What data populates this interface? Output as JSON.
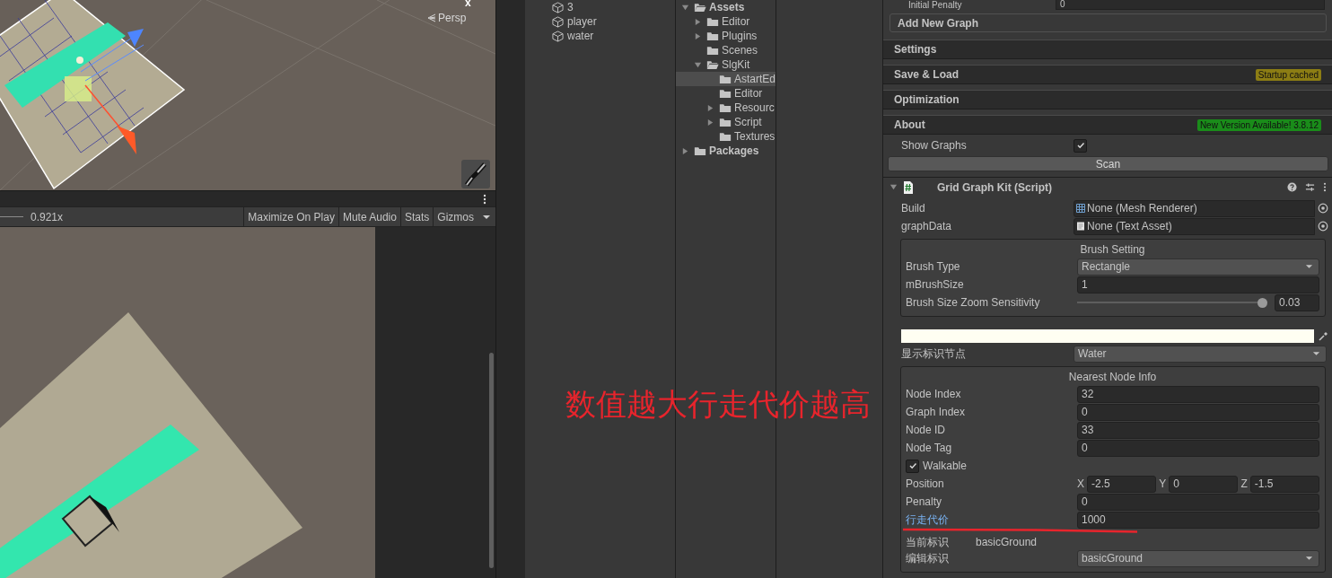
{
  "scene_view": {
    "close_glyph": "x",
    "camera_label": "Persp"
  },
  "game_view": {
    "scale": "0.921x",
    "buttons": [
      "Maximize On Play",
      "Mute Audio",
      "Stats",
      "Gizmos"
    ]
  },
  "hierarchy": {
    "items": [
      {
        "name": "3"
      },
      {
        "name": "player"
      },
      {
        "name": "water"
      }
    ]
  },
  "project": {
    "tree": [
      {
        "label": "Assets",
        "expanded": true,
        "selected": false,
        "children": [
          {
            "label": "Editor",
            "expanded": false,
            "selected": false
          },
          {
            "label": "Plugins",
            "expanded": false,
            "selected": false
          },
          {
            "label": "Scenes",
            "selected": false
          },
          {
            "label": "SlgKit",
            "expanded": true,
            "selected": false,
            "children": [
              {
                "label": "AstartEd",
                "selected": true
              },
              {
                "label": "Editor",
                "selected": false
              },
              {
                "label": "Resourc",
                "expanded": false,
                "selected": false
              },
              {
                "label": "Script",
                "expanded": false,
                "selected": false
              },
              {
                "label": "Textures",
                "selected": false
              }
            ]
          }
        ]
      },
      {
        "label": "Packages",
        "expanded": false,
        "selected": false
      }
    ]
  },
  "inspector": {
    "cut_row": {
      "label": "Initial Penalty",
      "value": "0"
    },
    "add_button": "Add New Graph",
    "sections": [
      {
        "title": "Settings"
      },
      {
        "title": "Save & Load",
        "badge": {
          "text": "Startup cached",
          "color": "#8c7d14"
        }
      },
      {
        "title": "Optimization"
      },
      {
        "title": "About",
        "badge": {
          "text": "New Version Available! 3.8.12",
          "color": "#1a8c1a"
        }
      }
    ],
    "show_graphs": {
      "label": "Show Graphs",
      "checked": true
    },
    "scan_button": "Scan",
    "component": {
      "title": "Grid Graph Kit (Script)",
      "expanded": true,
      "object_fields": [
        {
          "label": "Build",
          "value": "None (Mesh Renderer)",
          "kind": "mesh"
        },
        {
          "label": "graphData",
          "value": "None (Text Asset)",
          "kind": "text"
        }
      ],
      "brush": {
        "title": "Brush Setting",
        "rows": [
          {
            "kind": "dropdown",
            "label": "Brush Type",
            "value": "Rectangle"
          },
          {
            "kind": "input",
            "label": "mBrushSize",
            "value": "1"
          },
          {
            "kind": "slider",
            "label": "Brush Size Zoom Sensitivity",
            "level": 1,
            "value": "0.03"
          }
        ]
      },
      "color_field": {
        "color": "#fffef2"
      },
      "tag_dropdown": {
        "label": "显示标识节点",
        "value": "Water"
      },
      "node_info": {
        "title": "Nearest Node Info",
        "rows": [
          {
            "kind": "input",
            "label": "Node Index",
            "value": "32",
            "highlighted": false
          },
          {
            "kind": "input",
            "label": "Graph Index",
            "value": "0",
            "highlighted": false
          },
          {
            "kind": "input",
            "label": "Node ID",
            "value": "33",
            "highlighted": false
          },
          {
            "kind": "input",
            "label": "Node Tag",
            "value": "0",
            "highlighted": false
          },
          {
            "kind": "checkbox",
            "label": "Walkable",
            "checked": true
          },
          {
            "kind": "vector",
            "label": "Position",
            "axes": [
              {
                "axis": "X",
                "value": "-2.5"
              },
              {
                "axis": "Y",
                "value": "0"
              },
              {
                "axis": "Z",
                "value": "-1.5"
              }
            ]
          },
          {
            "kind": "input",
            "label": "Penalty",
            "value": "0",
            "highlighted": false
          },
          {
            "kind": "input",
            "label": "行走代价",
            "value": "1000",
            "highlighted": true
          },
          {
            "kind": "plain",
            "label": "当前标识",
            "value": "basicGround"
          },
          {
            "kind": "dropdown",
            "label": "编辑标识",
            "value": "basicGround"
          }
        ]
      }
    }
  },
  "annotation": {
    "text": "数值越大行走代价越高"
  }
}
